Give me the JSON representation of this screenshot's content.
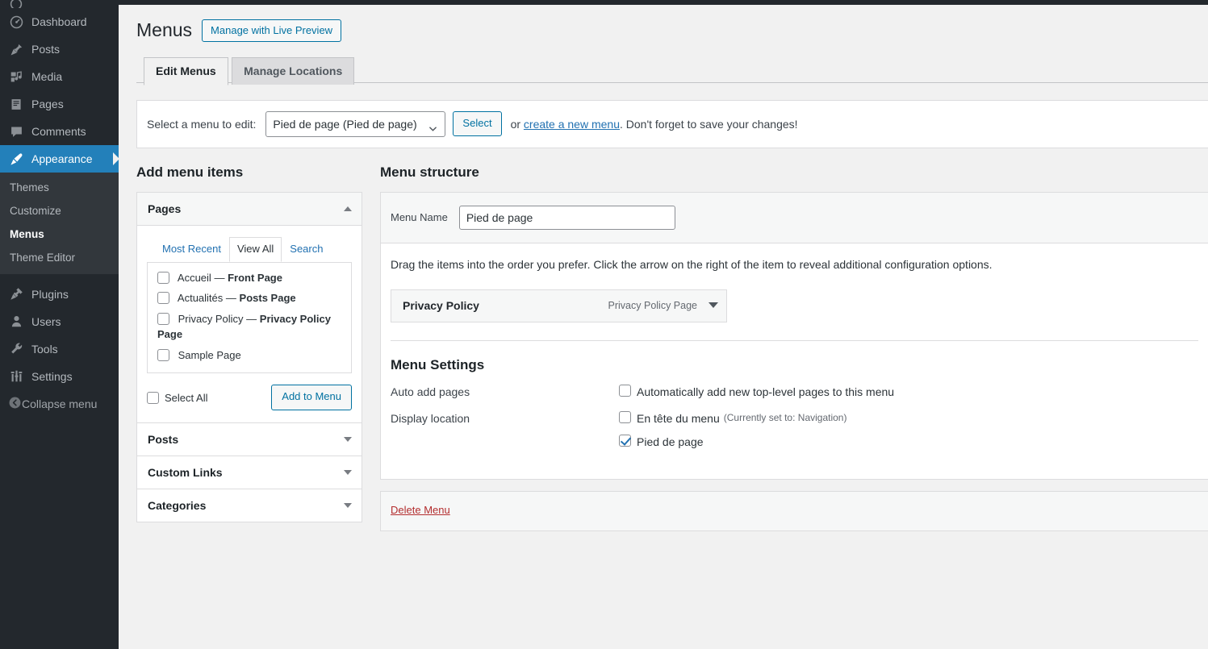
{
  "sidebar": {
    "items": [
      {
        "label": "Dashboard",
        "icon": "dashboard-icon",
        "current": false
      },
      {
        "label": "Posts",
        "icon": "posts-pin-icon",
        "current": false
      },
      {
        "label": "Media",
        "icon": "media-icon",
        "current": false
      },
      {
        "label": "Pages",
        "icon": "pages-icon",
        "current": false
      },
      {
        "label": "Comments",
        "icon": "comments-icon",
        "current": false
      },
      {
        "label": "Appearance",
        "icon": "appearance-brush-icon",
        "current": true
      },
      {
        "label": "Plugins",
        "icon": "plugins-icon",
        "current": false
      },
      {
        "label": "Users",
        "icon": "users-icon",
        "current": false
      },
      {
        "label": "Tools",
        "icon": "tools-wrench-icon",
        "current": false
      },
      {
        "label": "Settings",
        "icon": "settings-sliders-icon",
        "current": false
      }
    ],
    "appearance_submenu": [
      {
        "label": "Themes",
        "current": false
      },
      {
        "label": "Customize",
        "current": false
      },
      {
        "label": "Menus",
        "current": true
      },
      {
        "label": "Theme Editor",
        "current": false
      }
    ],
    "collapse": {
      "label": "Collapse menu",
      "icon": "collapse-arrow-icon"
    }
  },
  "header": {
    "title": "Menus",
    "live_preview_button": "Manage with Live Preview",
    "tabs": [
      {
        "label": "Edit Menus",
        "active": true
      },
      {
        "label": "Manage Locations",
        "active": false
      }
    ]
  },
  "menu_select_bar": {
    "label": "Select a menu to edit:",
    "selected_option": "Pied de page (Pied de page)",
    "options": [
      "Pied de page (Pied de page)"
    ],
    "select_button": "Select",
    "or_text": "or",
    "create_link": "create a new menu",
    "reminder_text": ". Don't forget to save your changes!"
  },
  "add_menu_items": {
    "heading": "Add menu items",
    "sections": [
      {
        "title": "Pages",
        "open": true,
        "tabs": [
          {
            "label": "Most Recent",
            "active": false
          },
          {
            "label": "View All",
            "active": true
          },
          {
            "label": "Search",
            "active": false
          }
        ],
        "items": [
          {
            "name": "Accueil",
            "dash": "—",
            "suffix": "Front Page",
            "checked": false
          },
          {
            "name": "Actualités",
            "dash": "—",
            "suffix": "Posts Page",
            "checked": false
          },
          {
            "name": "Privacy Policy",
            "dash": "—",
            "suffix": "Privacy Policy Page",
            "checked": false
          },
          {
            "name": "Sample Page",
            "dash": "",
            "suffix": "",
            "checked": false
          }
        ],
        "select_all_label": "Select All",
        "add_button": "Add to Menu"
      },
      {
        "title": "Posts",
        "open": false
      },
      {
        "title": "Custom Links",
        "open": false
      },
      {
        "title": "Categories",
        "open": false
      }
    ]
  },
  "menu_structure": {
    "heading": "Menu structure",
    "menu_name_label": "Menu Name",
    "menu_name_value": "Pied de page",
    "drag_hint": "Drag the items into the order you prefer. Click the arrow on the right of the item to reveal additional configuration options.",
    "items": [
      {
        "title": "Privacy Policy",
        "type": "Privacy Policy Page"
      }
    ]
  },
  "menu_settings": {
    "heading": "Menu Settings",
    "auto_add_label": "Auto add pages",
    "auto_add_option": "Automatically add new top-level pages to this menu",
    "auto_add_checked": false,
    "display_location_label": "Display location",
    "locations": [
      {
        "label": "En tête du menu",
        "note": "(Currently set to: Navigation)",
        "checked": false
      },
      {
        "label": "Pied de page",
        "note": "",
        "checked": true
      }
    ]
  },
  "delete": {
    "label": "Delete Menu"
  },
  "colors": {
    "sidebar_bg": "#23282d",
    "submenu_bg": "#32373c",
    "accent_blue": "#2271b1",
    "current_menu_bg": "#2380ba",
    "danger_red": "#b32d2e",
    "page_bg": "#f1f1f1"
  }
}
